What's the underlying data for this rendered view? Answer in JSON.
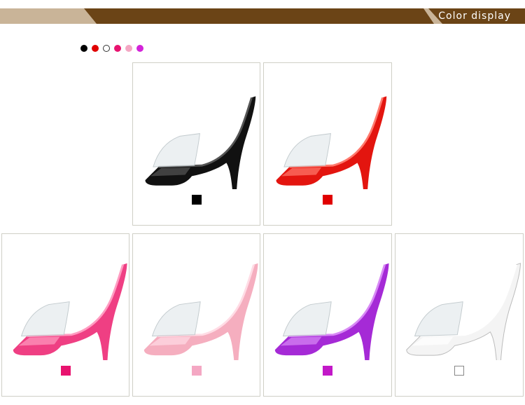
{
  "header": {
    "title": "Color display",
    "band_color": "#6b4416",
    "accent_color": "#c9b498"
  },
  "color_dots": [
    "#000000",
    "#e00000",
    "#ffffff",
    "#e8136f",
    "#f4a7c3",
    "#d324d9"
  ],
  "products": [
    {
      "name": "black",
      "sole": "#111111",
      "highlight": "#555555",
      "swatch": "#000000"
    },
    {
      "name": "red",
      "sole": "#e3150f",
      "highlight": "#ff7a6e",
      "swatch": "#e00000"
    },
    {
      "name": "rose",
      "sole": "#ef3f83",
      "highlight": "#ff9cc1",
      "swatch": "#e8136f"
    },
    {
      "name": "pink",
      "sole": "#f5aebf",
      "highlight": "#ffdce5",
      "swatch": "#f4a7c3"
    },
    {
      "name": "purple",
      "sole": "#a52ad6",
      "highlight": "#d88af5",
      "swatch": "#c218c8"
    },
    {
      "name": "white",
      "sole": "#f4f4f4",
      "highlight": "#ffffff",
      "swatch": "#ffffff"
    }
  ]
}
